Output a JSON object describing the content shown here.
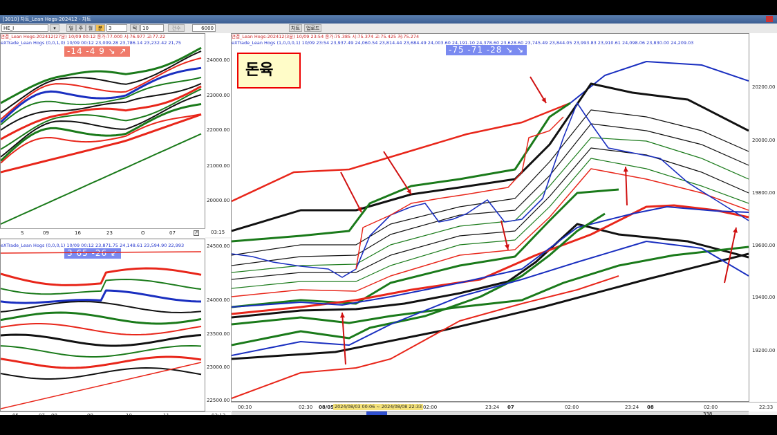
{
  "window": {
    "title": "[3010] 차트_Lean Hogs-202412 - 차트"
  },
  "toolbar": {
    "symbol": "HE_I",
    "period_buttons": [
      "일",
      "주",
      "월",
      "분",
      "틱"
    ],
    "period_value": "3",
    "count_value": "10",
    "count_label": "건수",
    "bars": "6000",
    "btn_chart": "차트",
    "btn_update": "업로드"
  },
  "left_top": {
    "header1": "연결_Lean Hogs-202412(27분) 10/09 00:12 종가:77.000 시:76.977 고:77.22",
    "header2": "eXTrade_Lean Hogs (0,0,1,0) 10/09 00:12 23,009.28 23,786.14 23,232.42 21,75",
    "badge": "-14  -4  9  ↘ ↗",
    "y_ticks": [
      "24000.00",
      "23000.00",
      "22000.00",
      "21000.00",
      "20000.00"
    ],
    "x_ticks": [
      "S",
      "09",
      "16",
      "23",
      "O",
      "07"
    ],
    "time": "03:15"
  },
  "left_bottom": {
    "header": "eXTrade_Lean Hogs (0,0,0,1) 10/09 00:12 23,871.75 24,148.61 23,594.90 22,993",
    "badge": "3  65  -26  ↙",
    "y_ticks": [
      "24500.00",
      "24000.00",
      "23500.00",
      "23000.00",
      "22500.00"
    ],
    "x_ticks": [
      "05",
      "07",
      "08",
      "09",
      "10",
      "11"
    ],
    "time": "03:12"
  },
  "main": {
    "header1": "연결_Lean Hogs-202412(3분) 10/09 23:54 종가:75.385 시:75.374 고:75.425 저:75.274",
    "header2": "eXTrade_Lean Hogs (1,0,0,0,1) 10/09 23:54 23,937.49 24,060.54 23,814.44 23,684.49 24,003.60 24,191.10 24,378.60 23,628.60 23,745.49 23,844.05 23,993.83 23,910.61 24,098.06 23,830.00 24,209.03",
    "badge": "-75  -71  -28  ↘ ↘",
    "label": "돈육",
    "y_ticks": [
      "20200.00",
      "20000.00",
      "19800.00",
      "19600.00",
      "19400.00",
      "19200.00"
    ],
    "x_ticks": [
      "00:30",
      "02:30",
      "08/05",
      "02:00",
      "23:24",
      "07",
      "02:00",
      "23:24",
      "08",
      "02:00",
      "22:33"
    ],
    "date_range": "2024/08/03 00:06 ~ 2024/08/08 22:33",
    "zoom": "338"
  },
  "colors": {
    "red": "#e8261a",
    "green": "#1a7a1a",
    "blue": "#1a2fc0",
    "black": "#111111",
    "arrow": "#d01010"
  }
}
